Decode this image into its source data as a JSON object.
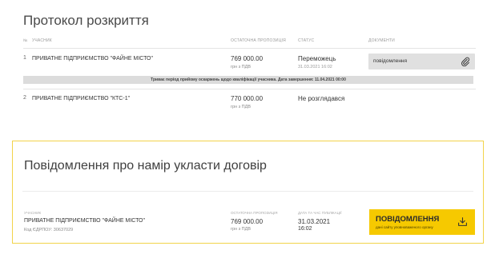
{
  "protocol": {
    "title": "Протокол розкриття",
    "columns": {
      "num": "№",
      "participant": "учасник",
      "offer": "остаточна пропозиція",
      "status": "статус",
      "documents": "документи"
    },
    "rows": [
      {
        "num": "1",
        "participant": "ПРИВАТНЕ ПІДПРИЄМСТВО \"ФАЙНЕ МІСТО\"",
        "amount": "769 000.00",
        "vat": "грн з ПДВ",
        "status": "Переможець",
        "status_date": "31.03.2021 16:02",
        "document_label": "повідомлення"
      },
      {
        "num": "2",
        "participant": "ПРИВАТНЕ ПІДПРИЄМСТВО \"КТС-1\"",
        "amount": "770 000.00",
        "vat": "грн з ПДВ",
        "status": "Не розглядався"
      }
    ],
    "notice": "Триває період прийому оскаржень щодо кваліфікації учасника. Дата завершення: 11.04.2021 00:00",
    "icons": {
      "document": "paperclip-icon"
    }
  },
  "intent": {
    "title": "Повідомлення про намір укласти договір",
    "labels": {
      "participant": "учасник",
      "offer": "остаточна пропозиція",
      "published": "дата та час публікації"
    },
    "participant": "ПРИВАТНЕ ПІДПРИЄМСТВО \"ФАЙНЕ МІСТО\"",
    "edrpou": "Код ЄДРПОУ: 30637029",
    "amount": "769 000.00",
    "vat": "грн з ПДВ",
    "date": "31.03.2021",
    "time": "16:02",
    "button": {
      "title": "ПОВІДОМЛЕННЯ",
      "subtitle": "дані сайту уповноваженого органу",
      "icon": "download-icon"
    }
  },
  "colors": {
    "accent": "#f6c900",
    "card_border": "#f2d34a",
    "notice_bg": "#dcdcdc",
    "doc_button_bg": "#e0e0e0"
  }
}
